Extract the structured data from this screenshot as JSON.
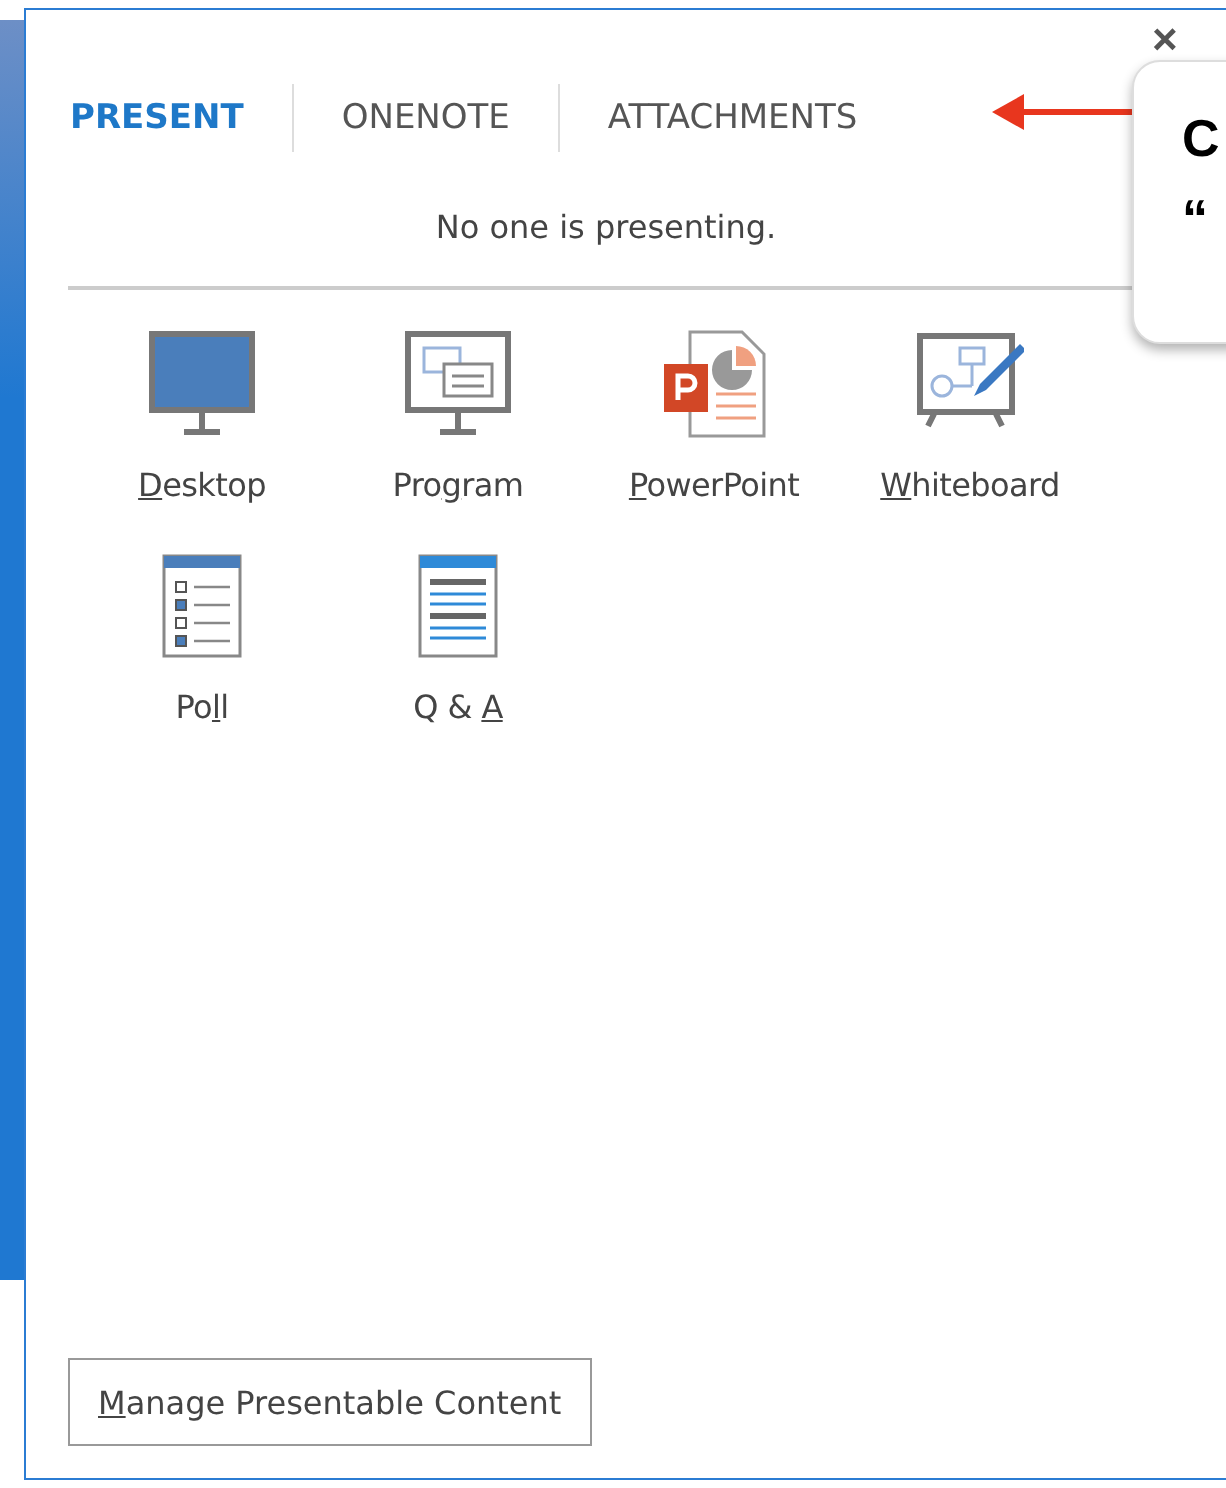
{
  "tabs": [
    {
      "label": "PRESENT",
      "selected": true
    },
    {
      "label": "ONENOTE",
      "selected": false
    },
    {
      "label": "ATTACHMENTS",
      "selected": false
    }
  ],
  "close": "×",
  "status": "No one is presenting.",
  "items": [
    {
      "kind": "desktop",
      "key": "D",
      "post": "esktop"
    },
    {
      "kind": "program",
      "pre": "Pro",
      "key": "g",
      "post": "ram"
    },
    {
      "kind": "powerpoint",
      "key": "P",
      "post": "owerPoint"
    },
    {
      "kind": "whiteboard",
      "key": "W",
      "post": "hiteboard"
    },
    {
      "kind": "poll",
      "pre": "Po",
      "key": "l",
      "post": "l"
    },
    {
      "kind": "qa",
      "pre": "Q & ",
      "key": "A"
    }
  ],
  "manage_button": {
    "key": "M",
    "post": "anage Presentable Content"
  },
  "callout": {
    "lines": [
      "C",
      "“"
    ]
  }
}
